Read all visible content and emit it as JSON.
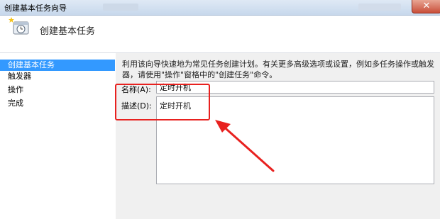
{
  "window": {
    "title": "创建基本任务向导",
    "close_glyph": "✕"
  },
  "header": {
    "title": "创建基本任务",
    "icon": "task-scheduler-wizard-icon"
  },
  "sidebar": {
    "items": [
      {
        "label": "创建基本任务",
        "active": true
      },
      {
        "label": "触发器",
        "active": false
      },
      {
        "label": "操作",
        "active": false
      },
      {
        "label": "完成",
        "active": false
      }
    ]
  },
  "main": {
    "description": "利用该向导快速地为常见任务创建计划。有关更多高级选项或设置，例如多任务操作或触发器，请使用\"操作\"窗格中的\"创建任务\"命令。",
    "name_label": "名称(A):",
    "name_value": "定时开机",
    "desc_label": "描述(D):",
    "desc_value": "定时开机"
  },
  "annotation": {
    "color": "#e8211f"
  }
}
